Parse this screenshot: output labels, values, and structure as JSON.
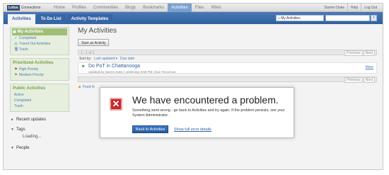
{
  "app": {
    "logo": "Lotus",
    "product": "Connections"
  },
  "nav": {
    "items": [
      {
        "label": "Home"
      },
      {
        "label": "Profiles"
      },
      {
        "label": "Communities"
      },
      {
        "label": "Blogs"
      },
      {
        "label": "Bookmarks"
      },
      {
        "label": "Activities"
      },
      {
        "label": "Files"
      },
      {
        "label": "Wikis"
      }
    ]
  },
  "user": {
    "name": "Darren Duke",
    "help": "Help",
    "logout": "Log Out"
  },
  "tabs": [
    {
      "label": "Activities"
    },
    {
      "label": "To Do List"
    },
    {
      "label": "Activity Templates"
    }
  ],
  "search": {
    "scope": "My Activities",
    "button": "›"
  },
  "sidebar": {
    "my_activities": "My Activities",
    "completed": "Completed",
    "tuned_out": "Tuned Out Activities",
    "trash": "Trash",
    "prioritized_title": "Prioritized Activities",
    "high_priority": "High Priority",
    "medium_priority": "Medium Priority",
    "public_title": "Public Activities",
    "public_active": "Active",
    "public_completed": "Completed",
    "public_trash": "Trash",
    "recent_updates": "Recent updates",
    "tags": "Tags",
    "loading": "Loading...",
    "people": "People"
  },
  "main": {
    "title": "My Activities",
    "start_button": "Start an Activity",
    "count": "1 - 1 of 1",
    "prev": "Previous",
    "next": "Next",
    "sort_by": "Sort by:",
    "last_updated": "Last updated ▾",
    "due_date": "Due date",
    "activity_name": "Do PoT in Chattanooga",
    "activity_meta": "updated by Darren Duke | yesterday 5:58 PM | Due Tomorrow",
    "more": "More",
    "feed": "Feed fo"
  },
  "error": {
    "title": "We have encountered a problem.",
    "message": "Something went wrong - go back to Activities and try again. If the problem persists, see your System Administrator.",
    "back_button": "Back to Activities",
    "details_link": "Show full error details"
  }
}
